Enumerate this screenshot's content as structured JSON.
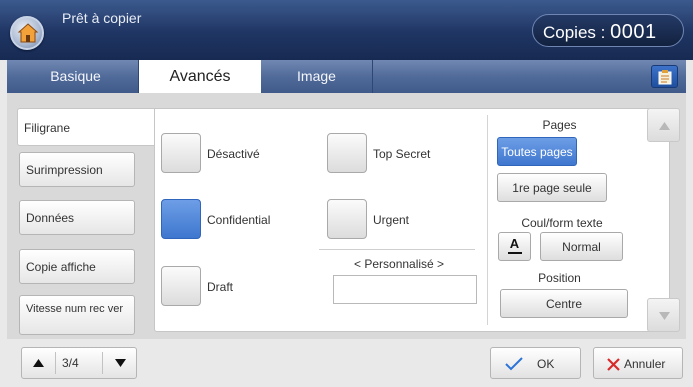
{
  "header": {
    "status_text": "Prêt à copier",
    "copies_label": "Copies : ",
    "copies_value": "0001"
  },
  "tabs": [
    {
      "label": "Basique",
      "active": false
    },
    {
      "label": "Avancés",
      "active": true
    },
    {
      "label": "Image",
      "active": false
    }
  ],
  "left_menu": [
    {
      "label": "Filigrane",
      "active": true
    },
    {
      "label": "Surimpression",
      "active": false
    },
    {
      "label": "Données",
      "active": false
    },
    {
      "label": "Copie affiche",
      "active": false
    },
    {
      "label": "Vitesse num rec ver",
      "active": false
    }
  ],
  "watermark_options": [
    {
      "label": "Désactivé",
      "selected": false
    },
    {
      "label": "Confidential",
      "selected": true
    },
    {
      "label": "Draft",
      "selected": false
    },
    {
      "label": "Top Secret",
      "selected": false
    },
    {
      "label": "Urgent",
      "selected": false
    }
  ],
  "custom": {
    "label": "< Personnalisé >",
    "value": ""
  },
  "pages": {
    "label": "Pages",
    "all_pages": "Toutes pages",
    "first_page": "1re page seule",
    "selected": "Toutes pages"
  },
  "text_style": {
    "label": "Coul/form texte",
    "color_glyph": "A",
    "format_value": "Normal"
  },
  "position": {
    "label": "Position",
    "value": "Centre"
  },
  "pager": {
    "current": "3/4"
  },
  "actions": {
    "ok_label": "OK",
    "cancel_label": "Annuler"
  },
  "colors": {
    "accent_blue": "#3f77cf",
    "header_navy": "#1f3563",
    "tab_bar": "#4e6897",
    "cancel_red": "#d92a2a",
    "ok_check_blue": "#2b74d8"
  }
}
